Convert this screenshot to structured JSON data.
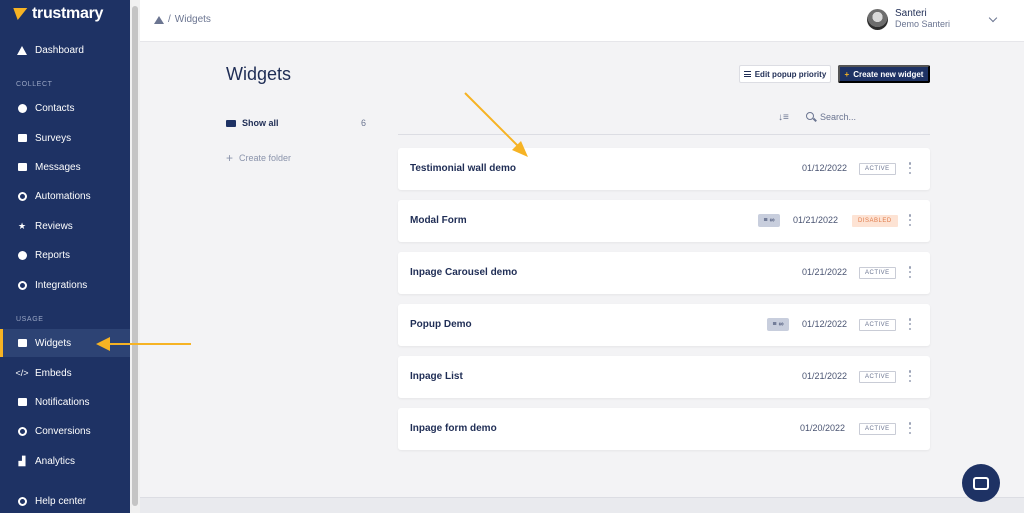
{
  "brand": {
    "name": "trustmary"
  },
  "sidebar": {
    "items": [
      {
        "label": "Dashboard",
        "icon": "house-icon"
      },
      {
        "label": "Contacts",
        "icon": "users-icon"
      },
      {
        "label": "Surveys",
        "icon": "survey-icon"
      },
      {
        "label": "Messages",
        "icon": "envelope-icon"
      },
      {
        "label": "Automations",
        "icon": "sync-icon"
      },
      {
        "label": "Reviews",
        "icon": "star-icon"
      },
      {
        "label": "Reports",
        "icon": "pie-chart-icon"
      },
      {
        "label": "Integrations",
        "icon": "link-icon"
      },
      {
        "label": "Widgets",
        "icon": "widget-icon"
      },
      {
        "label": "Embeds",
        "icon": "code-icon"
      },
      {
        "label": "Notifications",
        "icon": "comment-icon"
      },
      {
        "label": "Conversions",
        "icon": "conversion-icon"
      },
      {
        "label": "Analytics",
        "icon": "line-chart-icon"
      },
      {
        "label": "Help center",
        "icon": "lifebuoy-icon"
      }
    ],
    "sections": {
      "collect": "COLLECT",
      "usage": "USAGE"
    },
    "active": "Widgets"
  },
  "header": {
    "breadcrumb_sep": "/",
    "breadcrumb_page": "Widgets",
    "user_name": "Santeri",
    "user_org": "Demo Santeri"
  },
  "main": {
    "title": "Widgets",
    "edit_priority_label": "Edit popup priority",
    "create_widget_label": "Create new widget",
    "create_plus": "+",
    "folders": {
      "show_all": "Show all",
      "show_all_count": "6",
      "create_folder": "Create folder",
      "create_plus": "+"
    },
    "search_placeholder": "Search...",
    "sort_glyph": "↓≡",
    "widgets": [
      {
        "name": "Testimonial wall demo",
        "date": "01/12/2022",
        "status": "ACTIVE",
        "priority": ""
      },
      {
        "name": "Modal Form",
        "date": "01/21/2022",
        "status": "DISABLED",
        "priority": "≡ ∞"
      },
      {
        "name": "Inpage Carousel demo",
        "date": "01/21/2022",
        "status": "ACTIVE",
        "priority": ""
      },
      {
        "name": "Popup Demo",
        "date": "01/12/2022",
        "status": "ACTIVE",
        "priority": "≡ ∞"
      },
      {
        "name": "Inpage List",
        "date": "01/21/2022",
        "status": "ACTIVE",
        "priority": ""
      },
      {
        "name": "Inpage form demo",
        "date": "01/20/2022",
        "status": "ACTIVE",
        "priority": ""
      }
    ]
  },
  "colors": {
    "sidebar": "#1e3264",
    "accent": "#f6b324",
    "disabled_bg": "#fde3d4",
    "disabled_text": "#e07b4a"
  }
}
